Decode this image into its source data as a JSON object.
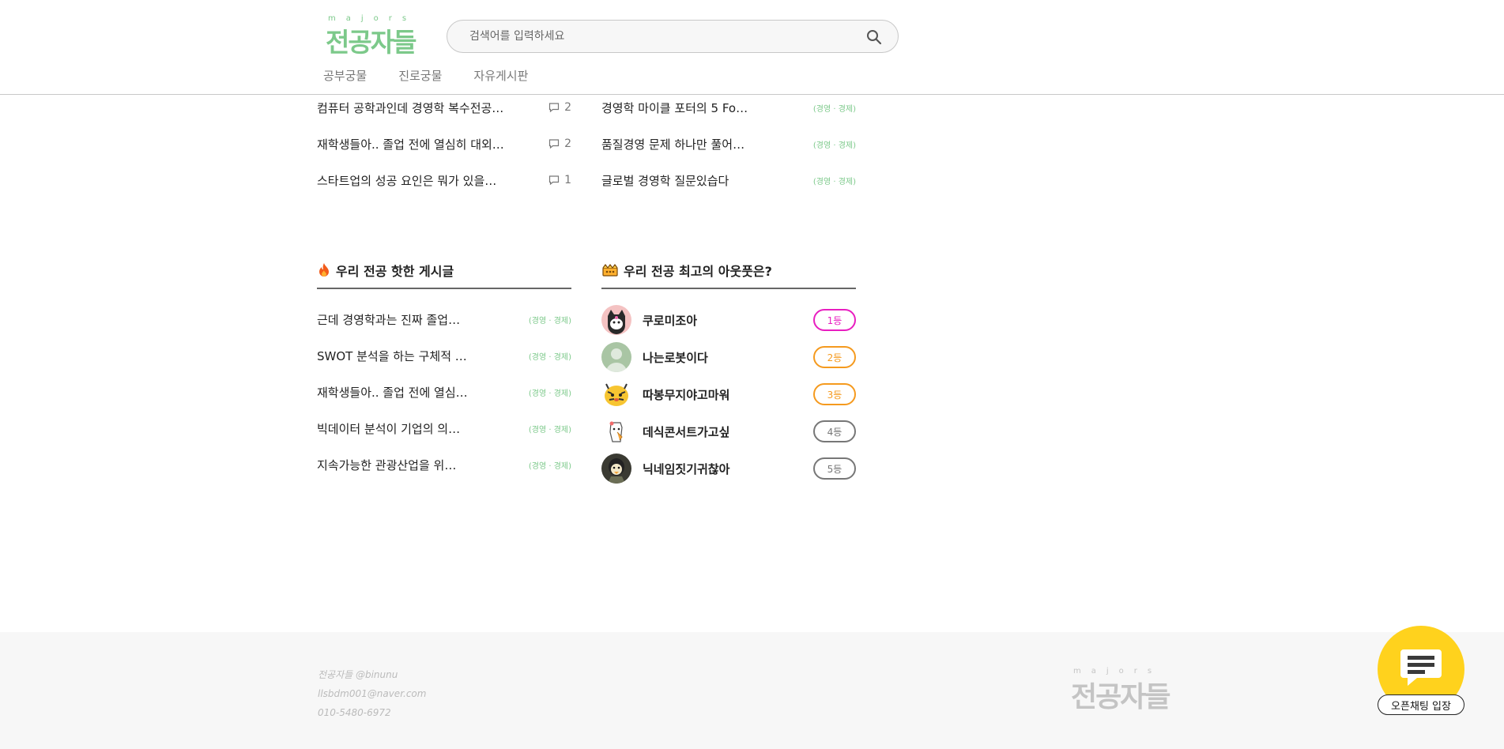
{
  "header": {
    "logo_sub": "majors",
    "logo_main": "전공자들",
    "search_placeholder": "검색어를 입력하세요",
    "nav": [
      "공부궁물",
      "진로궁물",
      "자유게시판"
    ]
  },
  "top_left_list": [
    {
      "title": "컴퓨터 공학과인데 경영학 복수전공…",
      "comments": "2"
    },
    {
      "title": "재학생들아.. 졸업 전에 열심히 대외…",
      "comments": "2"
    },
    {
      "title": "스타트업의 성공 요인은 뭐가 있을…",
      "comments": "1"
    }
  ],
  "top_right_list": [
    {
      "title": "경영학 마이클 포터의 5 Fo…",
      "tag": "(경영 · 경제)"
    },
    {
      "title": "품질경영 문제 하나만 풀어…",
      "tag": "(경영 · 경제)"
    },
    {
      "title": "글로벌 경영학 질문있습다",
      "tag": "(경영 · 경제)"
    }
  ],
  "hot_section": {
    "icon": "fire-icon",
    "title": "우리 전공 핫한 게시글",
    "items": [
      {
        "title": "근데 경영학과는 진짜 졸업…",
        "tag": "(경영 · 경제)"
      },
      {
        "title": "SWOT 분석을 하는 구체적 …",
        "tag": "(경영 · 경제)"
      },
      {
        "title": "재학생들아.. 졸업 전에 열심…",
        "tag": "(경영 · 경제)"
      },
      {
        "title": "빅데이터 분석이 기업의 의…",
        "tag": "(경영 · 경제)"
      },
      {
        "title": "지속가능한 관광산업을 위…",
        "tag": "(경영 · 경제)"
      }
    ]
  },
  "rank_section": {
    "icon": "crown-icon",
    "title": "우리 전공 최고의 아웃풋은?",
    "items": [
      {
        "name": "쿠로미조아",
        "rank": "1등",
        "color": "#e81ec0"
      },
      {
        "name": "나는로봇이다",
        "rank": "2등",
        "color": "#f59a1e"
      },
      {
        "name": "따봉무지야고마워",
        "rank": "3등",
        "color": "#f59a1e"
      },
      {
        "name": "데식콘서트가고싶",
        "rank": "4등",
        "color": "#777777"
      },
      {
        "name": "닉네임짓기귀찮아",
        "rank": "5등",
        "color": "#777777"
      }
    ]
  },
  "footer": {
    "lines": [
      "전공자들 @binunu",
      "llsbdm001@naver.com",
      "010-5480-6972"
    ],
    "logo_sub": "majors",
    "logo_main": "전공자들"
  },
  "chat": {
    "label": "오픈채팅 입장"
  },
  "colors": {
    "accent": "#7cc98a",
    "chat": "#ffd21d"
  }
}
